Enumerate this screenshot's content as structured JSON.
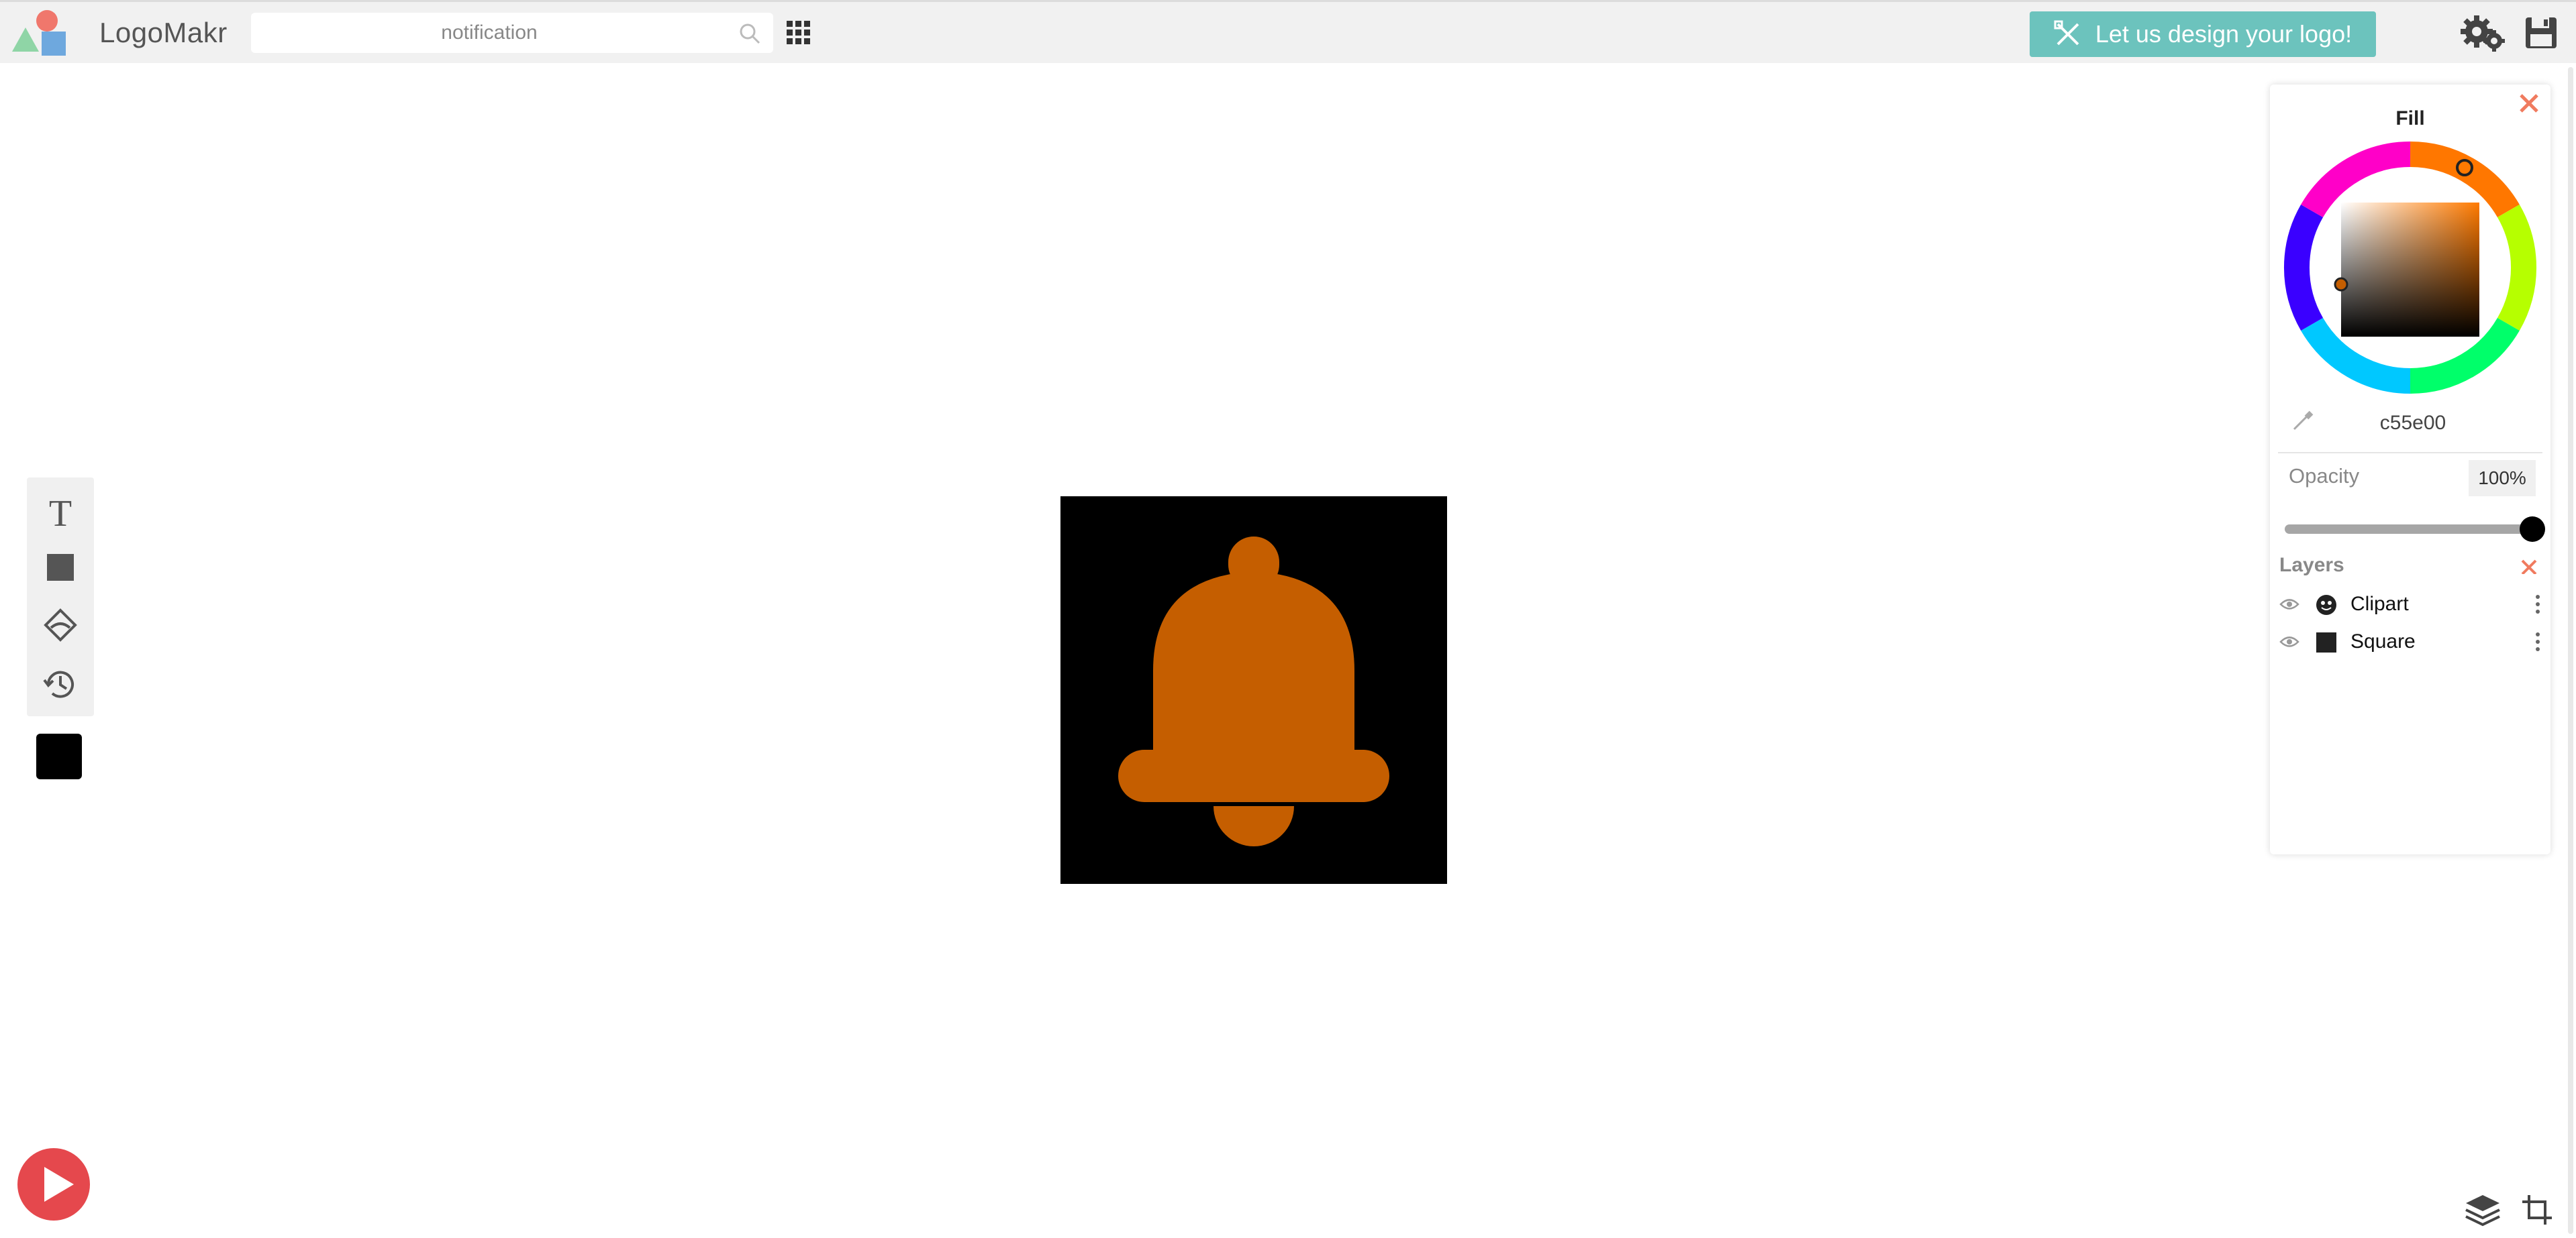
{
  "app": {
    "name": "LogoMakr"
  },
  "search": {
    "value": "notification"
  },
  "header": {
    "design_button_label": "Let us design your logo!"
  },
  "tools": {
    "text_glyph": "T"
  },
  "colors": {
    "accent": "#6cc3bd",
    "fill": "#c55e00",
    "canvas": "#000000",
    "close": "#f07b5f"
  },
  "fill_panel": {
    "title": "Fill",
    "hex": "c55e00",
    "opacity_label": "Opacity",
    "opacity_value": "100%",
    "opacity_fraction": 1.0
  },
  "layers_panel": {
    "title": "Layers",
    "items": [
      {
        "label": "Clipart",
        "icon": "clipart-icon"
      },
      {
        "label": "Square",
        "icon": "square-icon"
      }
    ]
  },
  "icons": [
    "search-icon",
    "grid-icon",
    "gear-icon",
    "save-icon",
    "text-tool-icon",
    "shape-tool-icon",
    "clipart-tool-icon",
    "history-icon",
    "eyedropper-icon",
    "eye-icon",
    "play-icon",
    "layers-icon",
    "crop-icon"
  ]
}
